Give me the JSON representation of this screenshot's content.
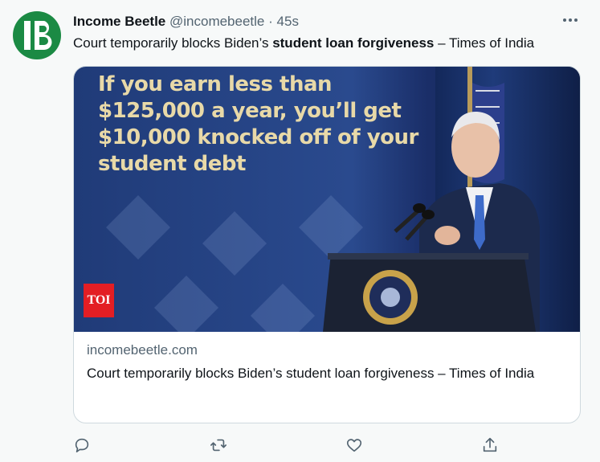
{
  "tweet": {
    "author_name": "Income Beetle",
    "author_handle": "@incomebeetle",
    "separator": "·",
    "timestamp": "45s",
    "avatar_initials": "IB",
    "more_icon": "more-horizontal-icon",
    "text_before": "Court temporarily blocks Biden’s ",
    "text_bold": "student loan forgiveness",
    "text_after": " – Times of India"
  },
  "card": {
    "image_caption": "If you earn less than $125,000 a year, you’ll get $10,000 knocked off of your student debt",
    "image_badge": "TOI",
    "domain": "incomebeetle.com",
    "title": "Court temporarily blocks Biden’s student loan forgiveness – Times of India"
  },
  "actions": [
    {
      "icon": "reply-icon"
    },
    {
      "icon": "retweet-icon"
    },
    {
      "icon": "like-icon"
    },
    {
      "icon": "share-icon"
    }
  ],
  "colors": {
    "avatar_bg": "#1b8a44",
    "secondary_text": "#536471",
    "border": "#cfd9de",
    "toi_red": "#e31e24"
  }
}
